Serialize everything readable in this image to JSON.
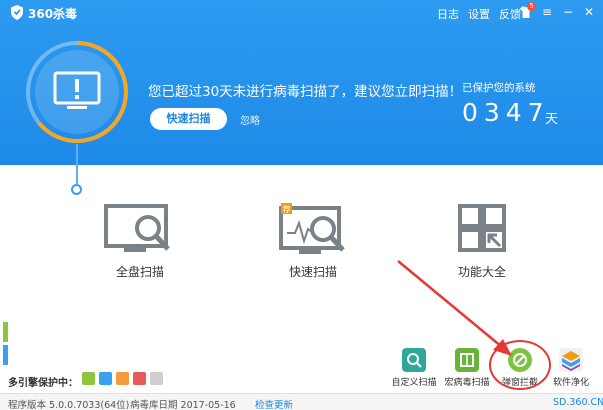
{
  "titlebar": {
    "app_title": "360杀毒",
    "links": [
      "日志",
      "设置",
      "反馈"
    ],
    "badge_count": "5",
    "icons": [
      "shield-logo-icon",
      "shirt-icon",
      "menu-icon",
      "minimize-icon",
      "close-icon"
    ]
  },
  "status": {
    "message": "您已超过30天未进行病毒扫描了，建议您立即扫描！",
    "quick_button": "快速扫描",
    "ignore": "忽略",
    "protected_label": "已保护您的系统",
    "protected_days": "0347",
    "days_unit": "天"
  },
  "tiles": [
    {
      "label": "全盘扫描",
      "icon": "full-scan-icon"
    },
    {
      "label": "快速扫描",
      "icon": "quick-scan-icon"
    },
    {
      "label": "功能大全",
      "icon": "feature-grid-icon"
    }
  ],
  "engines": {
    "label": "多引擎保护中：",
    "items": [
      "cloud-engine-icon",
      "qvm-engine-icon",
      "system-repair-icon",
      "avira-engine-icon",
      "bitdefender-engine-icon"
    ],
    "colors": [
      "#8cc63f",
      "#3aa0f0",
      "#f39c3c",
      "#e65a5a",
      "#cfcfcf"
    ]
  },
  "tools": [
    {
      "label": "自定义扫描",
      "icon": "custom-scan-icon"
    },
    {
      "label": "宏病毒扫描",
      "icon": "macro-scan-icon"
    },
    {
      "label": "弹窗拦截",
      "icon": "popup-block-icon"
    },
    {
      "label": "软件净化",
      "icon": "software-clean-icon"
    }
  ],
  "statusbar": {
    "version": "程序版本 5.0.0.7033(64位)",
    "db_date": "病毒库日期 2017-05-16",
    "update": "检查更新",
    "site": "SD.360.CN"
  },
  "colors": {
    "header": "#1e8ae8",
    "accent": "#1a86df",
    "highlight": "#e53935"
  }
}
